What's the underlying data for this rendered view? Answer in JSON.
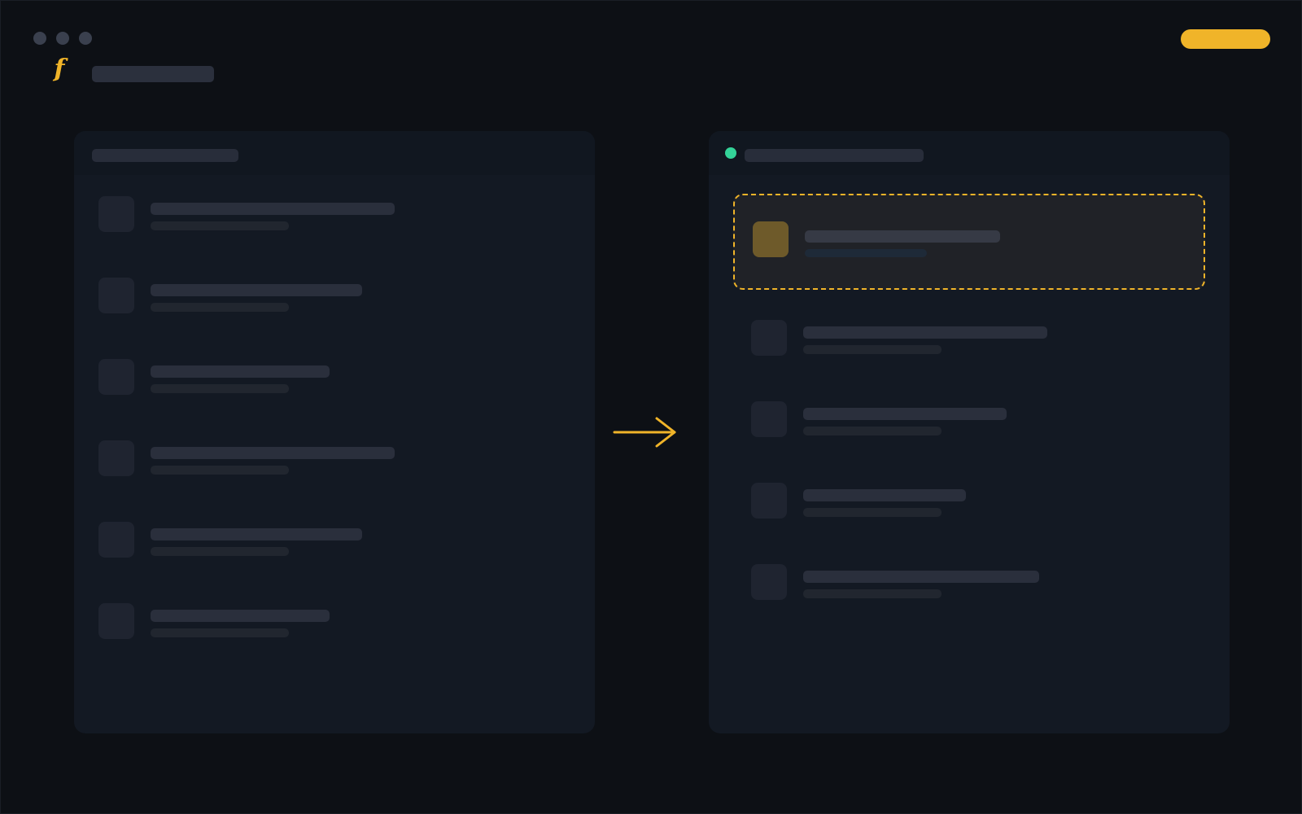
{
  "app": {
    "logo_glyph": "f",
    "accent_color": "#f0b429",
    "status_color": "#34d399"
  },
  "window": {
    "controls": [
      "window-dot-icon",
      "window-dot-icon",
      "window-dot-icon"
    ]
  },
  "header": {
    "action_pill": {
      "icon": "pill-button",
      "color": "#f0b429"
    }
  },
  "source_panel": {
    "row_count": 6
  },
  "target_panel": {
    "status": "online",
    "row_count": 6,
    "highlighted_row": 1
  },
  "transfer_arrow": {
    "icon": "arrow-right-icon",
    "color": "#f0b429"
  }
}
